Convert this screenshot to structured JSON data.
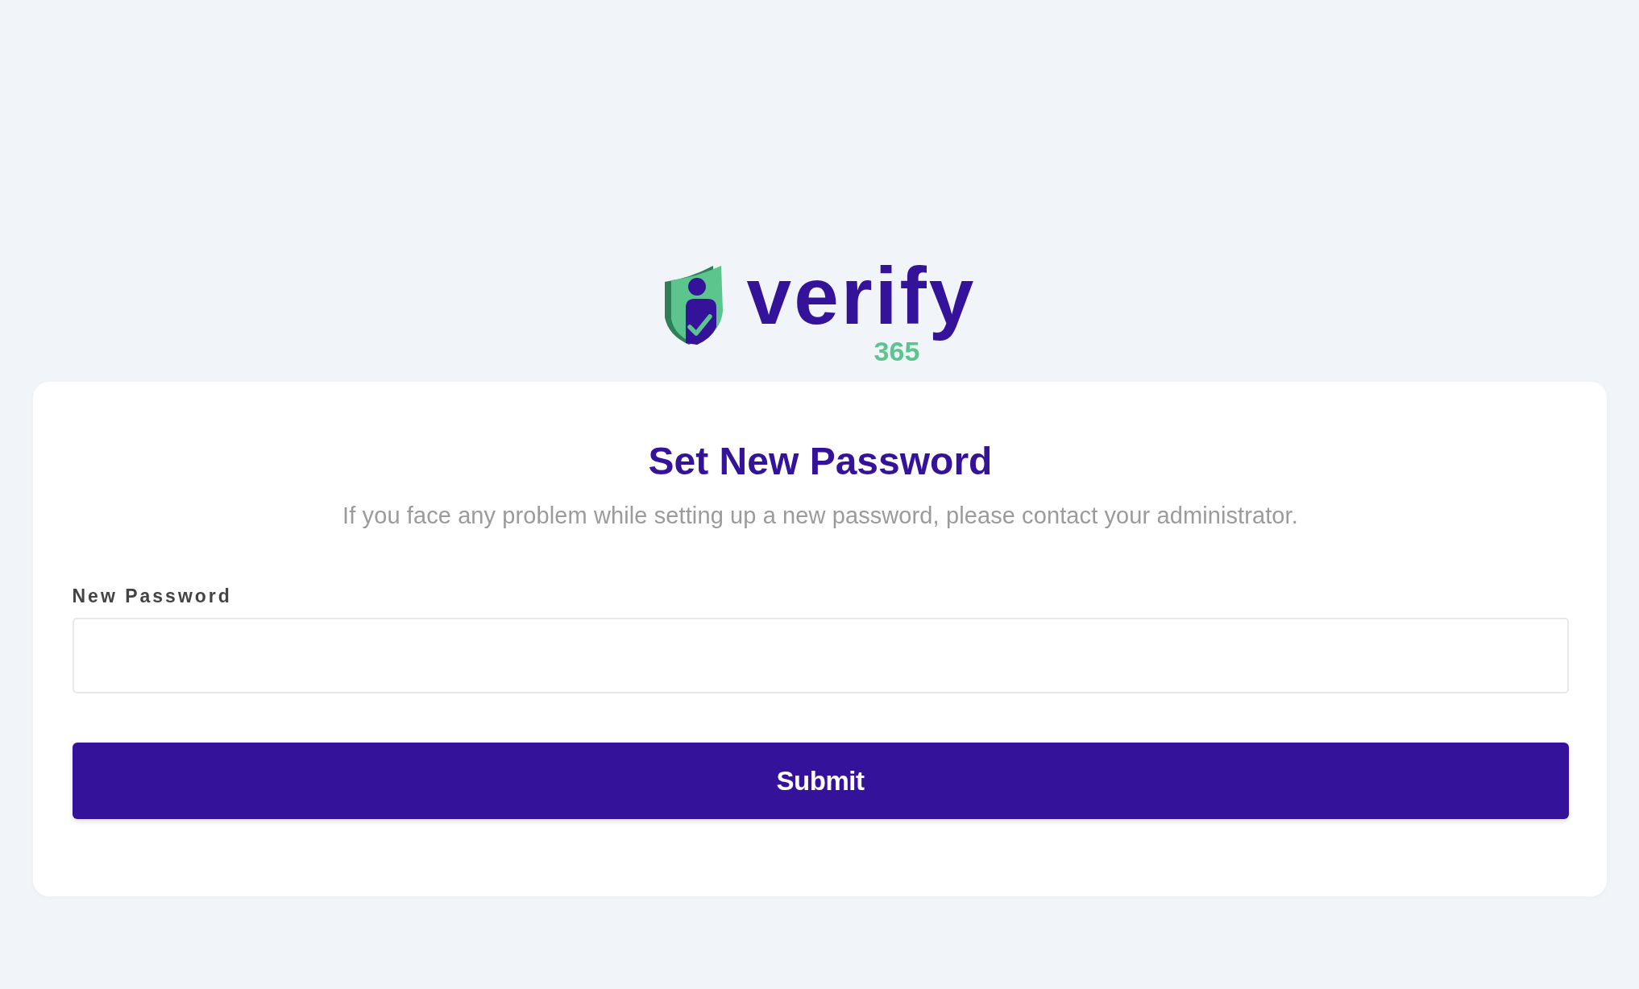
{
  "logo": {
    "wordmark": "verify",
    "suffix": "365"
  },
  "card": {
    "title": "Set New Password",
    "subtitle": "If you face any problem while setting up a new password, please contact your administrator."
  },
  "form": {
    "fields": [
      {
        "label": "New Password"
      }
    ],
    "submit": "Submit"
  }
}
